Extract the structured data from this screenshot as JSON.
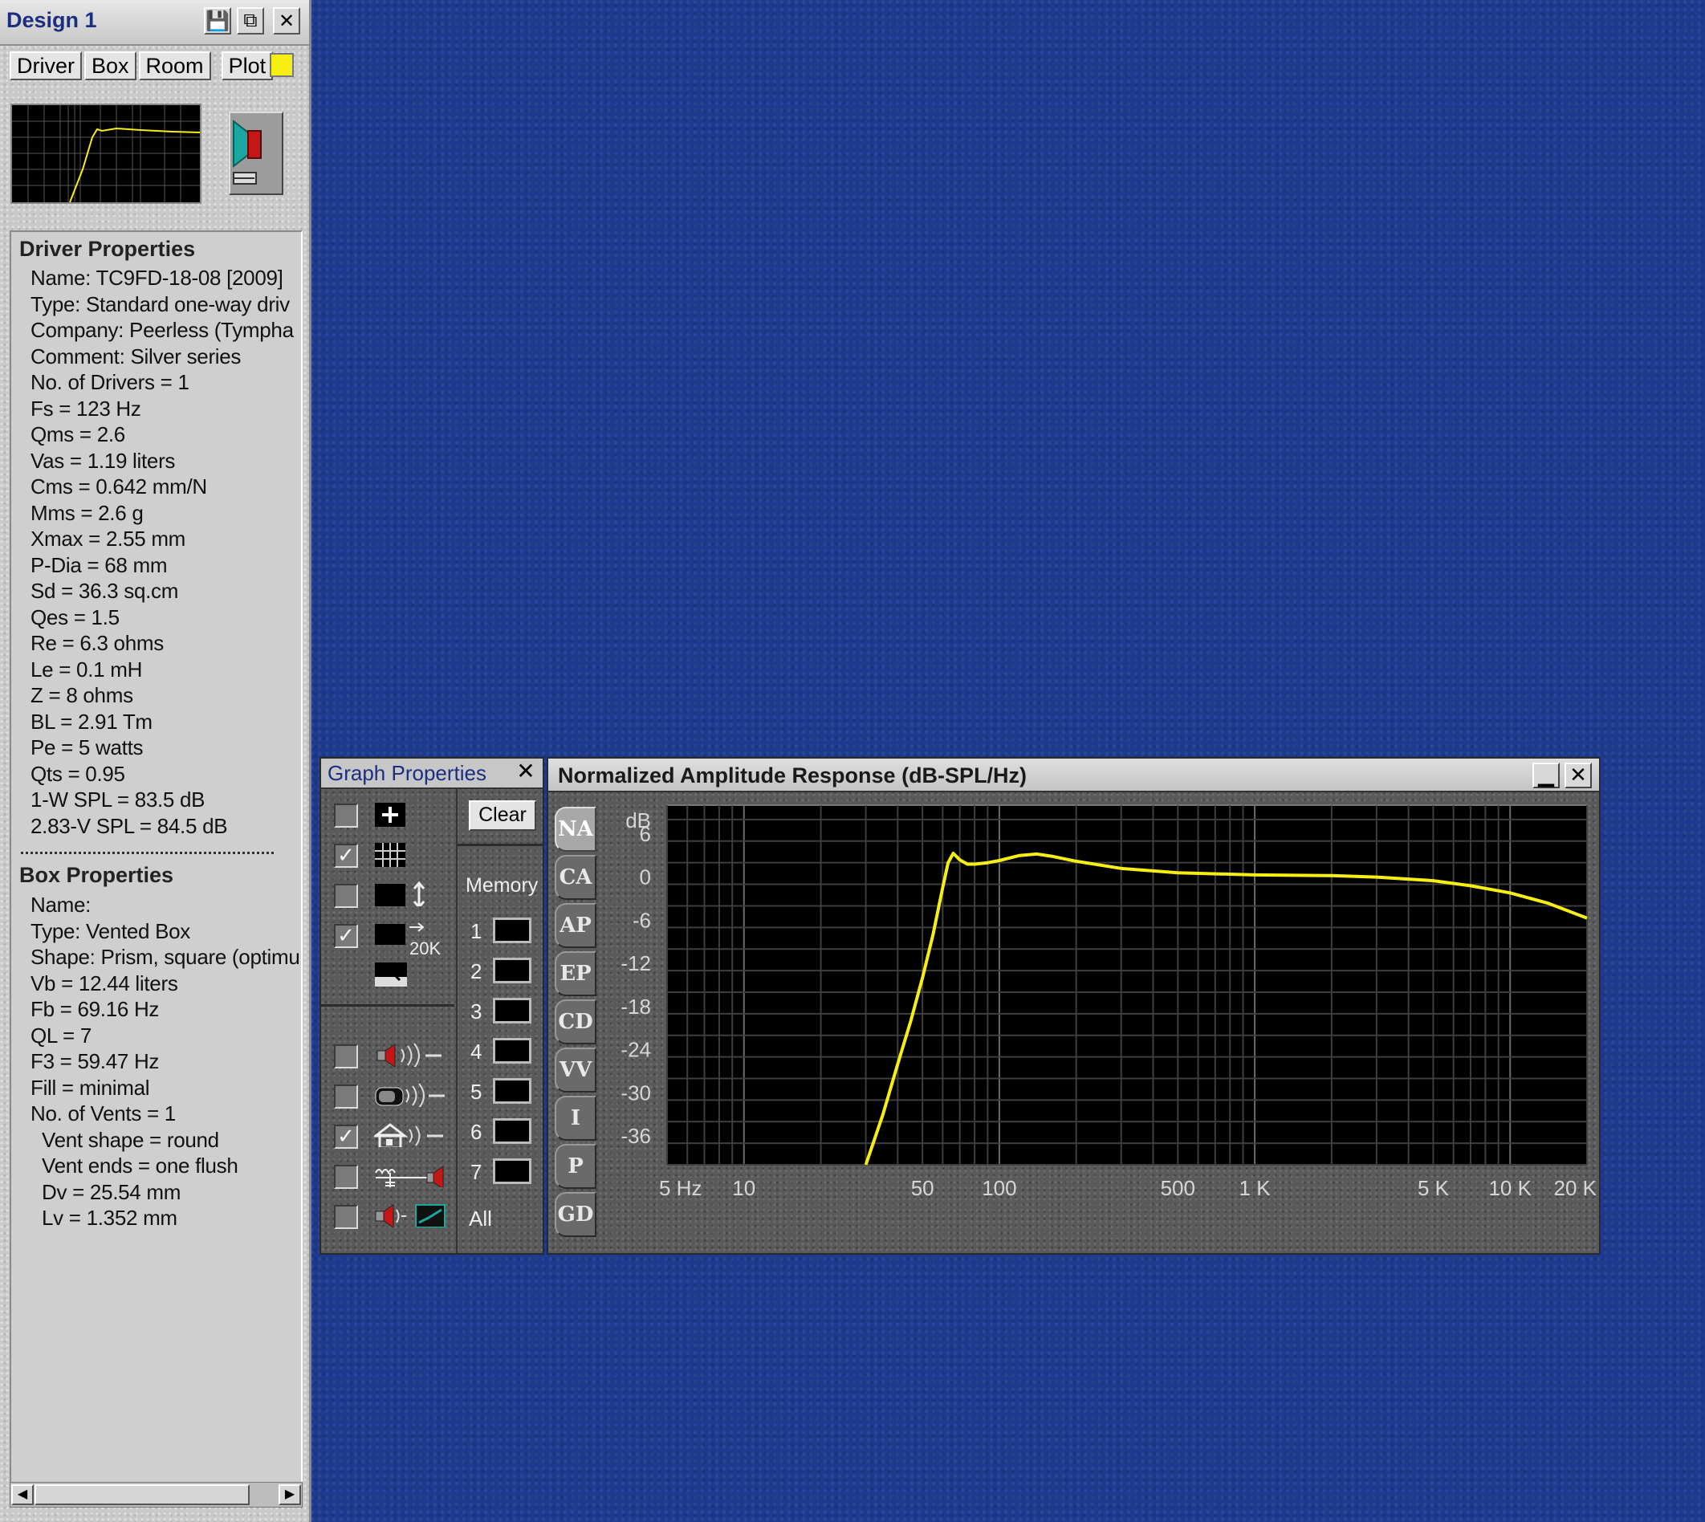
{
  "design": {
    "title": "Design 1",
    "tabs": [
      "Driver",
      "Box",
      "Room",
      "Plot"
    ],
    "plot_color": "#f7ee14",
    "driver_heading": "Driver Properties",
    "driver_lines": [
      "Name: TC9FD-18-08  [2009]",
      "Type: Standard one-way driv",
      "Company: Peerless  (Tympha",
      "Comment: Silver series",
      "No. of Drivers = 1",
      "Fs =  123 Hz",
      "Qms =  2.6",
      "Vas =  1.19 liters",
      "Cms =  0.642 mm/N",
      "Mms =  2.6 g",
      "Xmax =  2.55 mm",
      "P-Dia =  68 mm",
      "Sd =  36.3 sq.cm",
      "Qes =  1.5",
      "Re =  6.3 ohms",
      "Le =  0.1 mH",
      "Z =  8 ohms",
      "BL =  2.91 Tm",
      "Pe =  5 watts",
      "Qts =  0.95",
      "1-W SPL =  83.5 dB",
      "2.83-V SPL =  84.5 dB"
    ],
    "box_heading": "Box Properties",
    "box_lines": [
      "Name:",
      "Type: Vented Box",
      "Shape: Prism, square (optimu",
      "Vb =  12.44 liters",
      "Fb =  69.16 Hz",
      "QL =  7",
      "F3 =  59.47 Hz",
      "Fill = minimal",
      "No. of Vents = 1",
      " Vent shape = round",
      " Vent ends = one flush",
      " Dv =  25.54 mm",
      " Lv =  1.352 mm"
    ]
  },
  "graph_properties": {
    "title": "Graph Properties",
    "clear_label": "Clear",
    "memory_label": "Memory",
    "memory_slots": [
      "1",
      "2",
      "3",
      "4",
      "5",
      "6",
      "7"
    ],
    "all_label": "All",
    "range_label": "20K",
    "checkboxes": [
      {
        "name": "add-curve",
        "checked": false
      },
      {
        "name": "grid",
        "checked": true
      },
      {
        "name": "vertical-scale",
        "checked": false
      },
      {
        "name": "range-20k",
        "checked": true
      },
      {
        "name": "driver-output",
        "checked": false
      },
      {
        "name": "box-output",
        "checked": false
      },
      {
        "name": "room-output",
        "checked": true
      },
      {
        "name": "filter-output",
        "checked": false
      },
      {
        "name": "driver-filter",
        "checked": false
      },
      {
        "name": "port-filter",
        "checked": false
      }
    ]
  },
  "response": {
    "title": "Normalized Amplitude Response (dB-SPL/Hz)",
    "tabs": [
      "NA",
      "CA",
      "AP",
      "EP",
      "CD",
      "VV",
      "I",
      "P",
      "GD"
    ],
    "active_tab": "NA"
  },
  "chart_data": {
    "type": "line",
    "xscale": "log",
    "xlim": [
      5,
      20000
    ],
    "ylim": [
      -40,
      10
    ],
    "ylabel": "dB",
    "y_ticks": [
      6,
      0,
      -6,
      -12,
      -18,
      -24,
      -30,
      -36
    ],
    "x_ticks": [
      {
        "v": 5,
        "label": "5 Hz"
      },
      {
        "v": 10,
        "label": "10"
      },
      {
        "v": 50,
        "label": "50"
      },
      {
        "v": 100,
        "label": "100"
      },
      {
        "v": 500,
        "label": "500"
      },
      {
        "v": 1000,
        "label": "1 K"
      },
      {
        "v": 5000,
        "label": "5 K"
      },
      {
        "v": 10000,
        "label": "10 K"
      },
      {
        "v": 20000,
        "label": "20 K"
      }
    ],
    "grid": true,
    "series": [
      {
        "color": "#f7ee14",
        "x": [
          30,
          35,
          40,
          45,
          50,
          55,
          60,
          63,
          66,
          70,
          75,
          80,
          90,
          100,
          120,
          140,
          160,
          200,
          300,
          500,
          1000,
          2000,
          3000,
          5000,
          7000,
          10000,
          14000,
          20000
        ],
        "y": [
          -40,
          -33,
          -26,
          -20,
          -14,
          -8,
          -1.5,
          2,
          3.3,
          2.4,
          1.8,
          1.8,
          2,
          2.3,
          3,
          3.2,
          2.9,
          2.2,
          1.2,
          0.6,
          0.3,
          0.2,
          0,
          -0.5,
          -1.2,
          -2.2,
          -3.6,
          -5.7
        ]
      }
    ]
  }
}
